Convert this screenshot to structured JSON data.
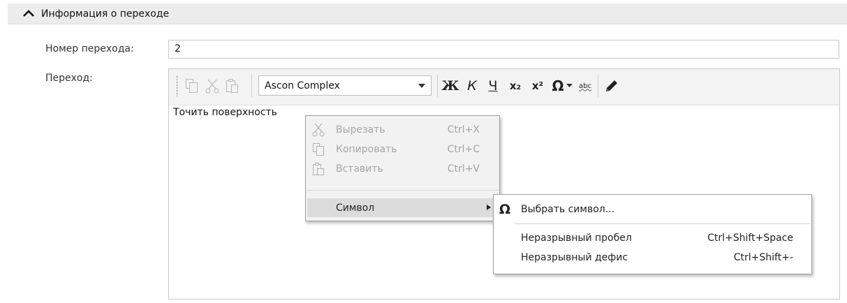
{
  "section": {
    "title": "Информация о переходе"
  },
  "transition_number": {
    "label": "Номер перехода:",
    "value": "2"
  },
  "transition": {
    "label": "Переход:",
    "text": "Точить поверхность"
  },
  "toolbar": {
    "font": "Ascon Complex",
    "bold": "Ж",
    "italic": "К",
    "underline": "Ч",
    "subscript": "x₂",
    "superscript": "x²",
    "symbol": "Ω",
    "spell": "abc"
  },
  "context_menu": {
    "items": [
      {
        "icon": "cut-icon",
        "label": "Вырезать",
        "shortcut": "Ctrl+X",
        "enabled": false
      },
      {
        "icon": "copy-icon",
        "label": "Копировать",
        "shortcut": "Ctrl+C",
        "enabled": false
      },
      {
        "icon": "paste-icon",
        "label": "Вставить",
        "shortcut": "Ctrl+V",
        "enabled": false
      },
      {
        "icon": "",
        "label": "Символ",
        "shortcut": "",
        "enabled": true,
        "submenu": true
      }
    ]
  },
  "submenu": {
    "items": [
      {
        "icon": "omega-icon",
        "label": "Выбрать символ...",
        "shortcut": ""
      },
      {
        "label": "Неразрывный пробел",
        "shortcut": "Ctrl+Shift+Space"
      },
      {
        "label": "Неразрывный дефис",
        "shortcut": "Ctrl+Shift+-"
      }
    ]
  }
}
